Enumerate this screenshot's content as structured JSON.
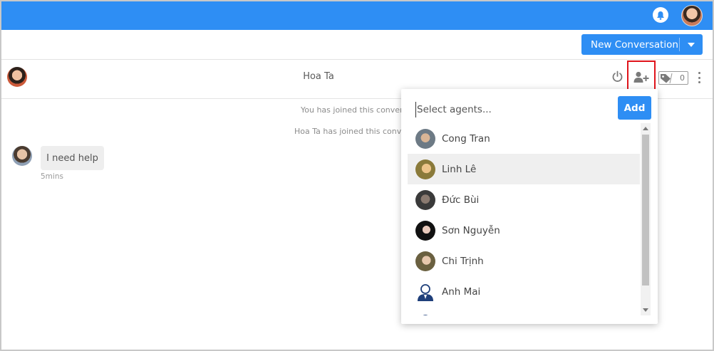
{
  "colors": {
    "accent": "#2e8ef4",
    "highlight_border": "#e0141b"
  },
  "topbar": {
    "notification_icon": "bell-icon",
    "user_avatar": "avatar"
  },
  "actionbar": {
    "new_conversation_label": "New Conversation"
  },
  "conversation": {
    "title": "Hoa Ta",
    "tag_count": "0",
    "system_messages": [
      "You has joined this conversa",
      "Hoa Ta has joined this convers"
    ],
    "messages": [
      {
        "text": "I need help",
        "time": "5mins"
      }
    ]
  },
  "agent_picker": {
    "placeholder": "Select agents...",
    "add_label": "Add",
    "agents": [
      {
        "name": "Cong Tran",
        "selected": false
      },
      {
        "name": "Linh Lê",
        "selected": true
      },
      {
        "name": "Đức Bùi",
        "selected": false
      },
      {
        "name": "Sơn Nguyễn",
        "selected": false
      },
      {
        "name": "Chi Trịnh",
        "selected": false
      },
      {
        "name": "Anh Mai",
        "selected": false
      }
    ]
  }
}
